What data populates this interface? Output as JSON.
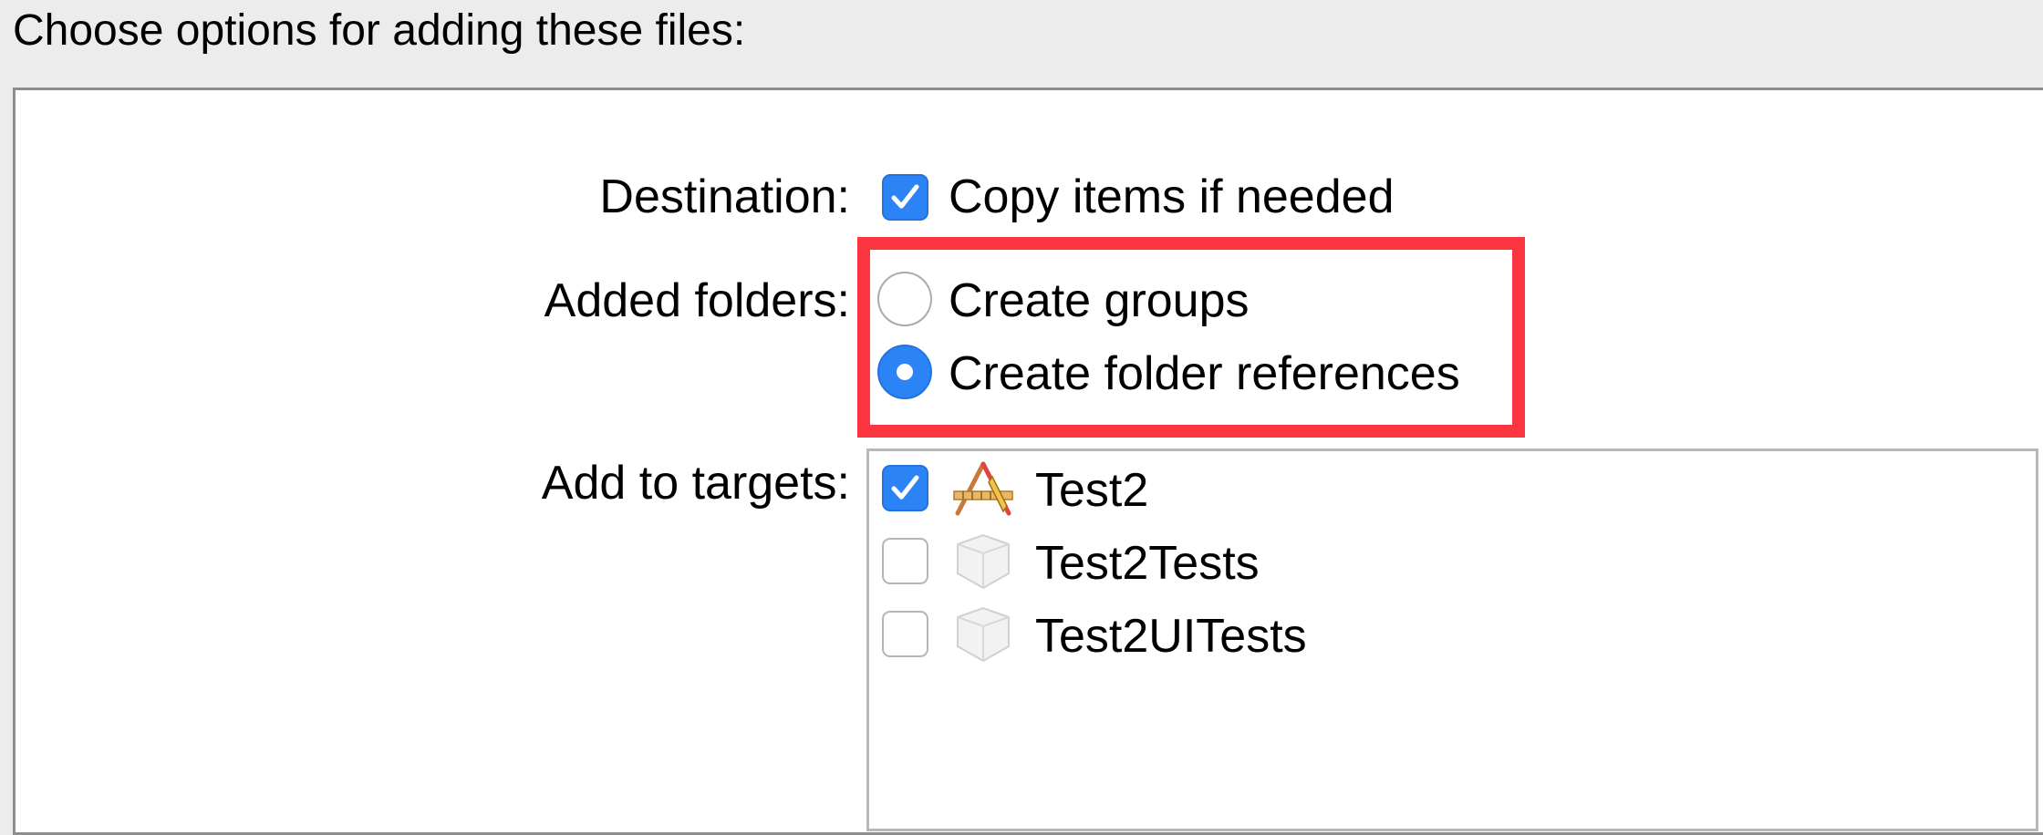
{
  "header": {
    "title": "Choose options for adding these files:"
  },
  "destination": {
    "label": "Destination:",
    "copy_items": {
      "label": "Copy items if needed",
      "checked": true
    }
  },
  "added_folders": {
    "label": "Added folders:",
    "options": [
      {
        "label": "Create groups",
        "selected": false
      },
      {
        "label": "Create folder references",
        "selected": true
      }
    ]
  },
  "targets": {
    "label": "Add to targets:",
    "items": [
      {
        "name": "Test2",
        "checked": true,
        "icon": "app-target-icon"
      },
      {
        "name": "Test2Tests",
        "checked": false,
        "icon": "test-bundle-icon"
      },
      {
        "name": "Test2UITests",
        "checked": false,
        "icon": "test-bundle-icon"
      }
    ]
  },
  "colors": {
    "accent": "#2b83f6",
    "highlight": "#fb3640",
    "panel_border": "#8e8e8e"
  }
}
